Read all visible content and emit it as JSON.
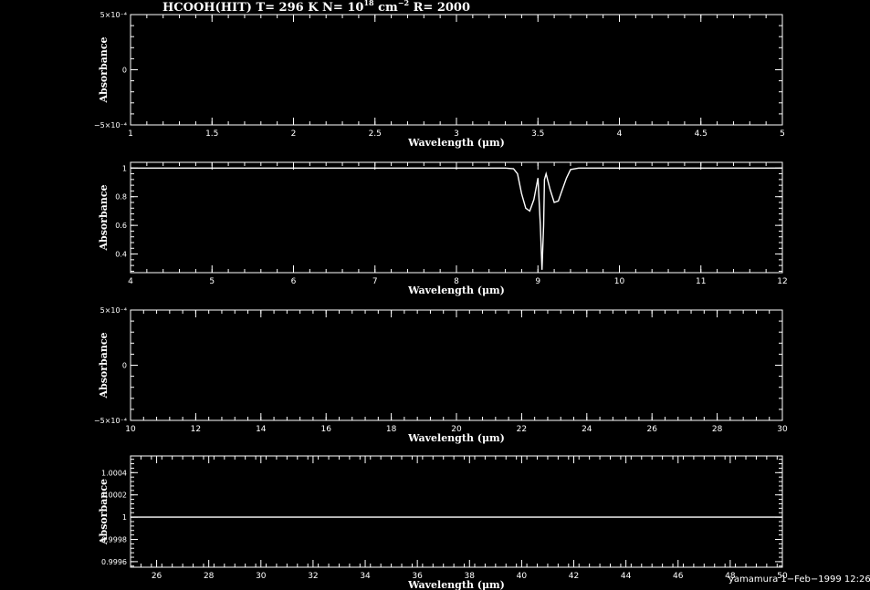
{
  "header": {
    "species": "HCOOH(HIT)",
    "t_label": "T=",
    "t_value": "296 K",
    "n_label": "N=",
    "n_base": "10",
    "n_exp": "18",
    "n_unit": "cm",
    "n_unit_exp": "−2",
    "r_label": "R=",
    "r_value": "2000"
  },
  "footer": {
    "user": "yamamura",
    "date": "1−Feb−1999 12:26"
  },
  "chart_data": [
    {
      "type": "line",
      "xlabel": "Wavelength (μm)",
      "ylabel": "Absorbance",
      "xlim": [
        1,
        5
      ],
      "ylim": [
        -0.0005,
        0.0005
      ],
      "xticks": [
        1,
        1.5,
        2,
        2.5,
        3,
        3.5,
        4,
        4.5,
        5
      ],
      "xtick_labels": [
        "1",
        "1.5",
        "2",
        "2.5",
        "3",
        "3.5",
        "4",
        "4.5",
        "5"
      ],
      "yticks": [
        -0.0005,
        0,
        0.0005
      ],
      "ytick_labels": [
        "−5×10⁻⁴",
        "0",
        "5×10⁻⁴"
      ],
      "series": []
    },
    {
      "type": "line",
      "xlabel": "Wavelength (μm)",
      "ylabel": "Absorbance",
      "xlim": [
        4,
        12
      ],
      "ylim": [
        0.27,
        1.04
      ],
      "xticks": [
        4,
        5,
        6,
        7,
        8,
        9,
        10,
        11,
        12
      ],
      "xtick_labels": [
        "4",
        "5",
        "6",
        "7",
        "8",
        "9",
        "10",
        "11",
        "12"
      ],
      "yticks": [
        0.4,
        0.6,
        0.8,
        1
      ],
      "ytick_labels": [
        "0.4",
        "0.6",
        "0.8",
        "1"
      ],
      "series": [
        {
          "x": [
            4,
            8.6,
            8.7,
            8.75,
            8.8,
            8.85,
            8.9,
            8.95,
            9.0,
            9.03,
            9.05,
            9.07,
            9.08,
            9.1,
            9.15,
            9.2,
            9.25,
            9.3,
            9.35,
            9.4,
            9.5,
            12
          ],
          "y": [
            1,
            1,
            0.995,
            0.96,
            0.82,
            0.72,
            0.7,
            0.78,
            0.93,
            0.6,
            0.29,
            0.6,
            0.92,
            0.96,
            0.85,
            0.76,
            0.77,
            0.85,
            0.93,
            0.99,
            1,
            1
          ]
        }
      ]
    },
    {
      "type": "line",
      "xlabel": "Wavelength (μm)",
      "ylabel": "Absorbance",
      "xlim": [
        10,
        30
      ],
      "ylim": [
        -0.0005,
        0.0005
      ],
      "xticks": [
        10,
        12,
        14,
        16,
        18,
        20,
        22,
        24,
        26,
        28,
        30
      ],
      "xtick_labels": [
        "10",
        "12",
        "14",
        "16",
        "18",
        "20",
        "22",
        "24",
        "26",
        "28",
        "30"
      ],
      "yticks": [
        -0.0005,
        0,
        0.0005
      ],
      "ytick_labels": [
        "−5×10⁻⁴",
        "0",
        "5×10⁻⁴"
      ],
      "series": []
    },
    {
      "type": "line",
      "xlabel": "Wavelength (μm)",
      "ylabel": "Absorbance",
      "xlim": [
        25,
        50
      ],
      "ylim": [
        0.99955,
        1.00055
      ],
      "xticks": [
        26,
        28,
        30,
        32,
        34,
        36,
        38,
        40,
        42,
        44,
        46,
        48,
        50
      ],
      "xtick_labels": [
        "26",
        "28",
        "30",
        "32",
        "34",
        "36",
        "38",
        "40",
        "42",
        "44",
        "46",
        "48",
        "50"
      ],
      "yticks": [
        0.9996,
        0.9998,
        1,
        1.0002,
        1.0004
      ],
      "ytick_labels": [
        "0.9996",
        "0.9998",
        "1",
        "1.0002",
        "1.0004"
      ],
      "series": [
        {
          "x": [
            25,
            50
          ],
          "y": [
            1,
            1
          ]
        }
      ]
    }
  ]
}
